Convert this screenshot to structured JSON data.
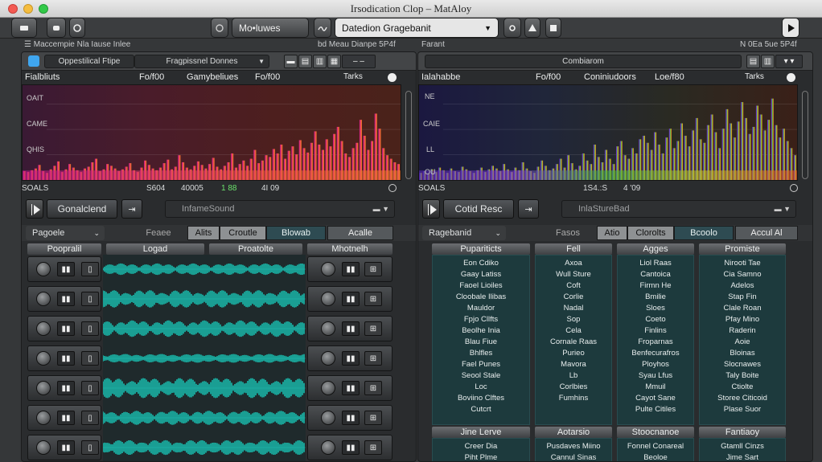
{
  "window": {
    "title": "Irsodication Clop – MatAloy"
  },
  "toolbar": {
    "mode_label": "Mo•luwes",
    "preset_label": "Datedion Gragebanit"
  },
  "crumbs": {
    "left": "☰ Maccempie Nla Iause Inlee",
    "left_right": "bd Meau Dianpe 5P4f",
    "right": "Farant",
    "right_right": "N 0Ea 5ue 5P4f"
  },
  "left": {
    "header": {
      "app": "Oppestilical Ftipe",
      "select": "Fragpissnel Donnes"
    },
    "labels": [
      "Fialbliuts",
      "Fo/f00",
      "Gamybeliues",
      "Fo/f00",
      "Tarks"
    ],
    "ylabels": [
      "OAIT",
      "CAME",
      "QHIS"
    ],
    "status": [
      "SOALS",
      "S604",
      "40005",
      "1 88",
      "4I 09"
    ],
    "player": {
      "name": "Gonalclend",
      "field": "InfameSound"
    },
    "drop": "Pagoele",
    "segs": [
      "Feaee",
      "Alits",
      "Croutle",
      "Blowab",
      "Acalle"
    ],
    "cols": [
      "Poopralil",
      "Logad",
      "Proatolte",
      "Mhotnelh"
    ],
    "spectrum": [
      10,
      9,
      11,
      13,
      17,
      10,
      8,
      12,
      16,
      21,
      9,
      12,
      18,
      14,
      11,
      9,
      13,
      15,
      20,
      24,
      10,
      12,
      18,
      16,
      13,
      10,
      12,
      15,
      19,
      11,
      9,
      14,
      22,
      17,
      13,
      11,
      14,
      19,
      23,
      12,
      15,
      28,
      20,
      14,
      12,
      16,
      21,
      17,
      13,
      18,
      25,
      15,
      12,
      16,
      20,
      30,
      14,
      18,
      22,
      16,
      24,
      34,
      19,
      22,
      28,
      26,
      35,
      30,
      40,
      24,
      33,
      38,
      29,
      45,
      36,
      31,
      42,
      55,
      40,
      34,
      46,
      38,
      52,
      60,
      44,
      30,
      26,
      36,
      42,
      68,
      50,
      34,
      44,
      75,
      58,
      36,
      28,
      24,
      20,
      18
    ],
    "waves": [
      0.35,
      0.6,
      0.55,
      0.25,
      0.7,
      0.45,
      0.5
    ]
  },
  "right": {
    "header": {
      "select": "Combiarom"
    },
    "labels": [
      "Ialahabbe",
      "Fo/f00",
      "Coniniudoors",
      "Loe/f80",
      "Tarks"
    ],
    "ylabels": [
      "NE",
      "CAIE",
      "LL",
      "OU"
    ],
    "status": [
      "SOALS",
      "1S4.:S",
      "4 '09"
    ],
    "player": {
      "name": "Cotid Resc",
      "field": "InlaStureBad"
    },
    "drop": "Ragebanid",
    "segs": [
      "Fasos",
      "Atio",
      "Clorolts",
      "Bcoolo",
      "Accul Al"
    ],
    "cols": [
      "Pupariticts",
      "Fell",
      "Agges",
      "Promiste"
    ],
    "lists": [
      [
        "Eon Cdiko",
        "Gaay Latiss",
        "Faoel Lioiles",
        "Cloobale Ilibas",
        "Mauldor",
        "Fpjo Cllfts",
        "Beolhe Inia",
        "Blau Fiue",
        "Bhlfles",
        "Fael Punes",
        "Seool Stale",
        "Loc",
        "Boviino Clftes",
        "Cutcrt"
      ],
      [
        "Axoa",
        "Wull Sture",
        "Coft",
        "Corlie",
        "Nadal",
        "Sop",
        "Cela",
        "Cornale Raas",
        "Purieo",
        "Mavora",
        "Lb",
        "Corlbies",
        "Fumhins"
      ],
      [
        "Liol Raas",
        "Cantoica",
        "Firmn He",
        "Bmilie",
        "Sloes",
        "Coeto",
        "Finlins",
        "Froparnas",
        "Benfecurafros",
        "Ployhos",
        "Syau Lfus",
        "Mmuil",
        "Cayot Sane",
        "Pulte Citiles"
      ],
      [
        "Nirooti Tae",
        "Cia Samno",
        "Adelos",
        "Stap Fin",
        "Clale Roan",
        "Pfay Mino",
        "Raderin",
        "Aoie",
        "Bloinas",
        "Slocnawes",
        "Taly Boite",
        "Ctiolte",
        "Storee Citicoid",
        "Plase Suor"
      ]
    ],
    "lists2": [
      [
        "Jine Lerve",
        "Creer Dia",
        "Piht Plme"
      ],
      [
        "Aotarsio",
        "Pusdaves Miino",
        "Cannul Sinas"
      ],
      [
        "Stoocnanoe",
        "Fonnel Conareal",
        "Beoloe"
      ],
      [
        "Fantiaoy",
        "Gtamll Cinzs",
        "Jime Sart"
      ]
    ],
    "spectrum": [
      8,
      10,
      7,
      12,
      9,
      14,
      11,
      8,
      13,
      10,
      9,
      15,
      12,
      10,
      8,
      11,
      14,
      9,
      12,
      16,
      13,
      10,
      18,
      12,
      9,
      14,
      11,
      20,
      13,
      10,
      8,
      15,
      22,
      16,
      11,
      13,
      18,
      24,
      14,
      28,
      19,
      12,
      16,
      30,
      22,
      18,
      40,
      26,
      20,
      34,
      24,
      18,
      38,
      44,
      28,
      24,
      36,
      30,
      46,
      50,
      42,
      34,
      54,
      40,
      30,
      48,
      58,
      36,
      44,
      64,
      50,
      38,
      56,
      70,
      46,
      42,
      62,
      74,
      54,
      36,
      58,
      80,
      64,
      48,
      66,
      88,
      70,
      52,
      60,
      84,
      74,
      56,
      68,
      92,
      62,
      48,
      58,
      44,
      36,
      28
    ],
    "accent": "#18d0c0"
  },
  "icons": [
    "record-icon",
    "car-icon",
    "circle-icon",
    "settings-icon",
    "wave-icon",
    "down-icon",
    "eye-icon",
    "play-icon"
  ]
}
